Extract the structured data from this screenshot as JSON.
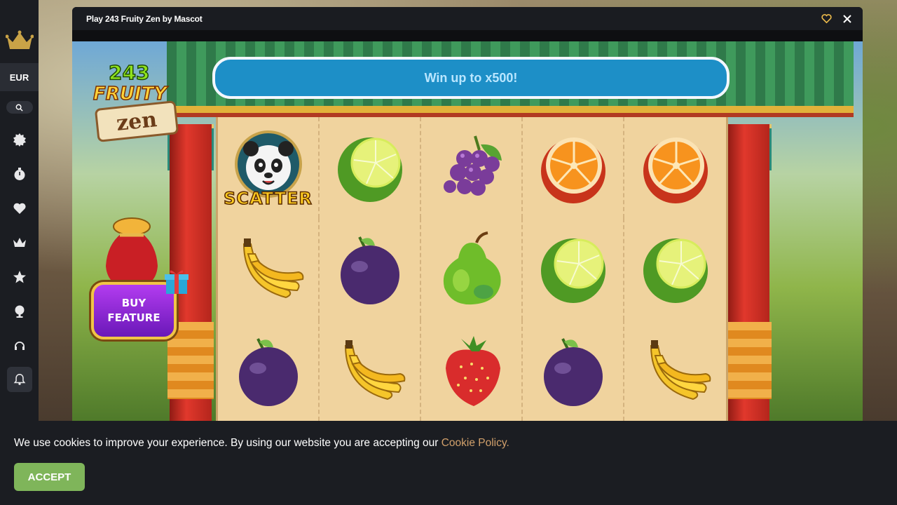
{
  "sidebar": {
    "currency": "EUR",
    "nav": [
      {
        "name": "new-games-icon"
      },
      {
        "name": "recent-icon"
      },
      {
        "name": "favorites-icon"
      },
      {
        "name": "vip-crown-icon"
      },
      {
        "name": "top-star-icon"
      },
      {
        "name": "trophy-icon"
      },
      {
        "name": "support-headset-icon"
      },
      {
        "name": "notifications-bell-icon"
      }
    ]
  },
  "modal": {
    "title": "Play 243 Fruity Zen by Mascot"
  },
  "game": {
    "logo": {
      "line1": "243",
      "line2": "FRUITY",
      "line3": "zen"
    },
    "banner": "Win up to x500!",
    "buy_feature": {
      "line1": "BUY",
      "line2": "FEATURE"
    },
    "scatter_label": "SCATTER",
    "reels": [
      [
        "scatter-panda",
        "lime",
        "grapes",
        "orange",
        "orange"
      ],
      [
        "banana",
        "plum",
        "pear",
        "lime",
        "lime"
      ],
      [
        "plum",
        "banana",
        "strawberry",
        "plum",
        "banana"
      ]
    ]
  },
  "cookie": {
    "text": "We use cookies to improve your experience. By using our website you are accepting our ",
    "link": "Cookie Policy.",
    "accept": "ACCEPT"
  },
  "colors": {
    "sidebar_bg": "#1b1d22",
    "accept_green": "#7fb55a",
    "link_tan": "#d1a06b",
    "banner_blue": "#1d8fc7"
  }
}
